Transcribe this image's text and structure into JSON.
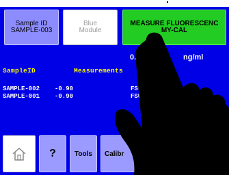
{
  "colors": {
    "screen_bg": "#0000e6",
    "sample_button": "#8c8cff",
    "module_button": "#ffffff",
    "measure_button": "#22cc22",
    "nav_button": "#9a9aff",
    "header_text": "#ffff00",
    "body_text": "#ffffff"
  },
  "top_buttons": {
    "sample_line1": "Sample ID",
    "sample_line2": "SAMPLE-003",
    "module_line1": "Blue",
    "module_line2": "Module",
    "measure_line1": "MEASURE FLUORESCENC",
    "measure_line2": "MY-CAL"
  },
  "reading": {
    "value": "0.00",
    "unit": "ng/ml"
  },
  "table": {
    "header_sample": "SampleID",
    "header_measurements": "Measurements",
    "rows": [
      {
        "id": "SAMPLE-002",
        "value": "-0.90",
        "unit": "FSU"
      },
      {
        "id": "SAMPLE-001",
        "value": "-0.90",
        "unit": "FSU"
      }
    ]
  },
  "nav": {
    "home_icon": "home-icon",
    "help_label": "?",
    "tools_label": "Tools",
    "calibrate_label": "Calibr"
  }
}
